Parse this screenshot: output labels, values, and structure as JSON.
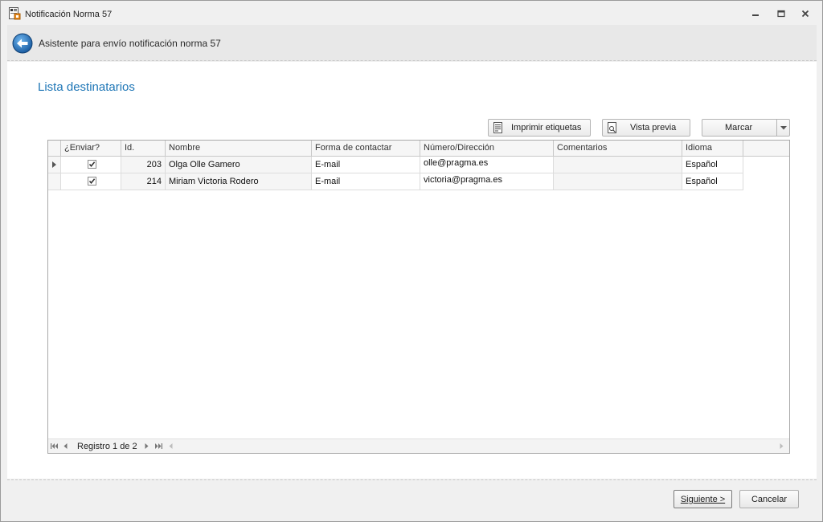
{
  "window": {
    "title": "Notificación Norma 57",
    "icon": "app-document-icon",
    "controls": [
      "minimize-icon",
      "restore-icon",
      "close-icon"
    ]
  },
  "wizard": {
    "title": "Asistente para envío notificación norma 57",
    "back_icon": "back-arrow-icon"
  },
  "section": {
    "title": "Lista destinatarios"
  },
  "toolbar": {
    "print_labels": "Imprimir etiquetas",
    "preview": "Vista previa",
    "mark": "Marcar"
  },
  "grid": {
    "columns": [
      "¿Enviar?",
      "Id.",
      "Nombre",
      "Forma de contactar",
      "Número/Dirección",
      "Comentarios",
      "Idioma"
    ],
    "rows": [
      {
        "enviar": true,
        "id": "203",
        "nombre": "Olga Olle Gamero",
        "forma": "E-mail",
        "direccion": "olle@pragma.es",
        "comentarios": "",
        "idioma": "Español"
      },
      {
        "enviar": true,
        "id": "214",
        "nombre": "Miriam Victoria Rodero",
        "forma": "E-mail",
        "direccion": "victoria@pragma.es",
        "comentarios": "",
        "idioma": "Español"
      }
    ],
    "navigator": {
      "record_text": "Registro 1 de 2"
    }
  },
  "footer": {
    "next": "Siguiente >",
    "cancel": "Cancelar"
  },
  "colors": {
    "accent": "#1e76b6",
    "panel": "#f0f0f0",
    "border": "#a9a9a9"
  }
}
